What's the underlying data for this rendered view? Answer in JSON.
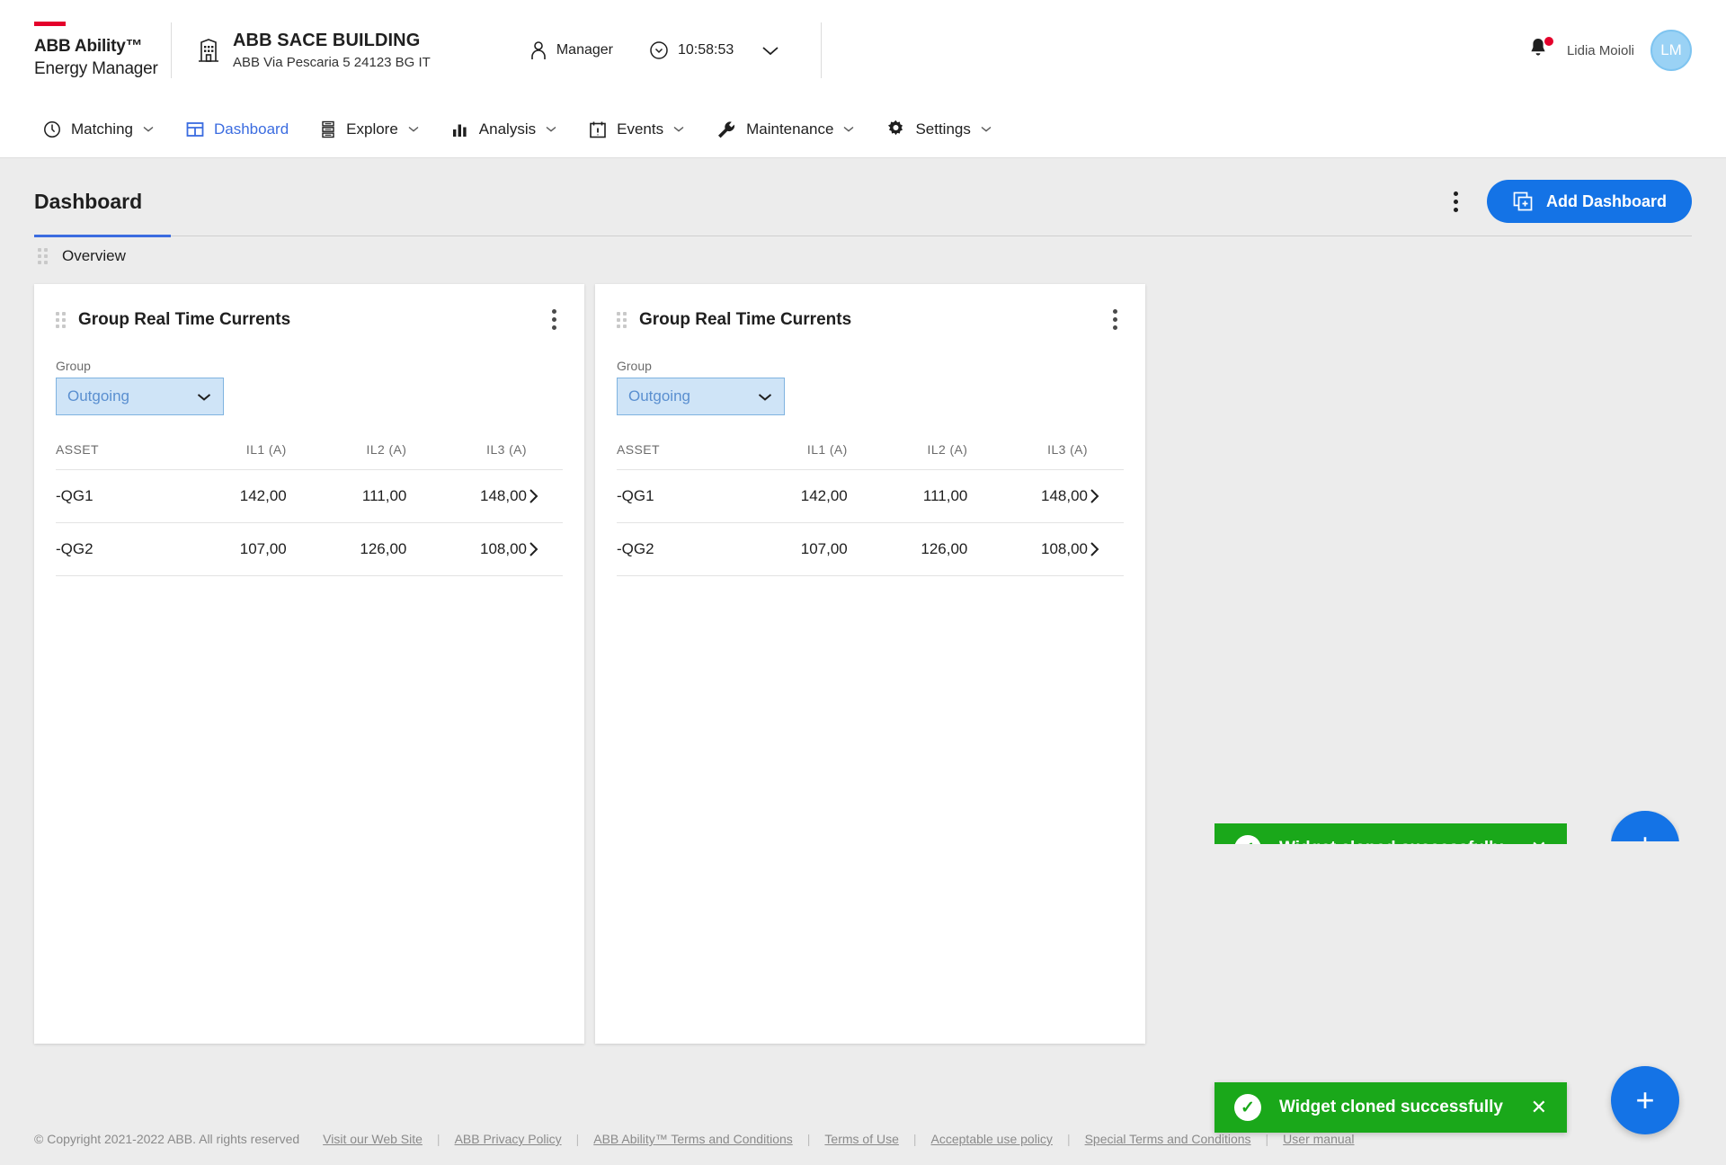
{
  "header": {
    "brand_line1": "ABB Ability™",
    "brand_line2": "Energy Manager",
    "building_icon": "building-icon",
    "site_name": "ABB SACE BUILDING",
    "site_address": "ABB Via Pescaria 5 24123 BG IT",
    "role_icon": "user-icon",
    "role_label": "Manager",
    "clock_icon": "clock-icon",
    "clock_time": "10:58:53",
    "context_caret_icon": "chevron-down-icon",
    "notification_icon": "bell-icon",
    "notification_badge": true,
    "user_name": "Lidia Moioli",
    "user_initials": "LM"
  },
  "nav": {
    "items": [
      {
        "label": "Matching",
        "icon": "matching-icon",
        "caret": true,
        "active": false
      },
      {
        "label": "Dashboard",
        "icon": "dashboard-icon",
        "caret": false,
        "active": true
      },
      {
        "label": "Explore",
        "icon": "explore-icon",
        "caret": true,
        "active": false
      },
      {
        "label": "Analysis",
        "icon": "analysis-icon",
        "caret": true,
        "active": false
      },
      {
        "label": "Events",
        "icon": "events-icon",
        "caret": true,
        "active": false
      },
      {
        "label": "Maintenance",
        "icon": "maintenance-icon",
        "caret": true,
        "active": false
      },
      {
        "label": "Settings",
        "icon": "settings-icon",
        "caret": true,
        "active": false
      }
    ]
  },
  "page": {
    "title": "Dashboard",
    "more_icon": "kebab-menu-icon",
    "add_dashboard_label": "Add Dashboard",
    "add_dashboard_icon": "add-dashboard-icon",
    "tab_label": "Overview",
    "tab_grip_icon": "drag-grip-icon"
  },
  "widgets": [
    {
      "title": "Group Real Time Currents",
      "grip_icon": "drag-grip-icon",
      "menu_icon": "kebab-menu-icon",
      "group_field_label": "Group",
      "group_value": "Outgoing",
      "group_caret_icon": "chevron-down-icon",
      "columns": [
        "ASSET",
        "IL1 (A)",
        "IL2 (A)",
        "IL3 (A)"
      ],
      "rows": [
        {
          "asset": "-QG1",
          "il1": "142,00",
          "il2": "111,00",
          "il3": "148,00",
          "arrow_icon": "chevron-right-icon"
        },
        {
          "asset": "-QG2",
          "il1": "107,00",
          "il2": "126,00",
          "il3": "108,00",
          "arrow_icon": "chevron-right-icon"
        }
      ]
    },
    {
      "title": "Group Real Time Currents",
      "grip_icon": "drag-grip-icon",
      "menu_icon": "kebab-menu-icon",
      "group_field_label": "Group",
      "group_value": "Outgoing",
      "group_caret_icon": "chevron-down-icon",
      "columns": [
        "ASSET",
        "IL1 (A)",
        "IL2 (A)",
        "IL3 (A)"
      ],
      "rows": [
        {
          "asset": "-QG1",
          "il1": "142,00",
          "il2": "111,00",
          "il3": "148,00",
          "arrow_icon": "chevron-right-icon"
        },
        {
          "asset": "-QG2",
          "il1": "107,00",
          "il2": "126,00",
          "il3": "108,00",
          "arrow_icon": "chevron-right-icon"
        }
      ]
    }
  ],
  "toasts": [
    {
      "message": "Widget cloned successfully",
      "icon": "check-circle-icon",
      "close_icon": "close-icon"
    },
    {
      "message": "Widget cloned successfully",
      "icon": "check-circle-icon",
      "close_icon": "close-icon"
    }
  ],
  "fab": {
    "icon": "plus-icon",
    "label": "+"
  },
  "footer": {
    "copyright": "© Copyright 2021-2022 ABB. All rights reserved",
    "links": [
      "Visit our Web Site",
      "ABB Privacy Policy",
      "ABB Ability™ Terms and Conditions",
      "Terms of Use",
      "Acceptable use policy",
      "Special Terms and Conditions",
      "User manual"
    ],
    "separator": "|"
  },
  "colors": {
    "abb_red": "#e4002b",
    "primary_blue": "#1473e6",
    "active_nav": "#3b6ce0",
    "success_green": "#1aa81a",
    "page_bg": "#ececec"
  }
}
